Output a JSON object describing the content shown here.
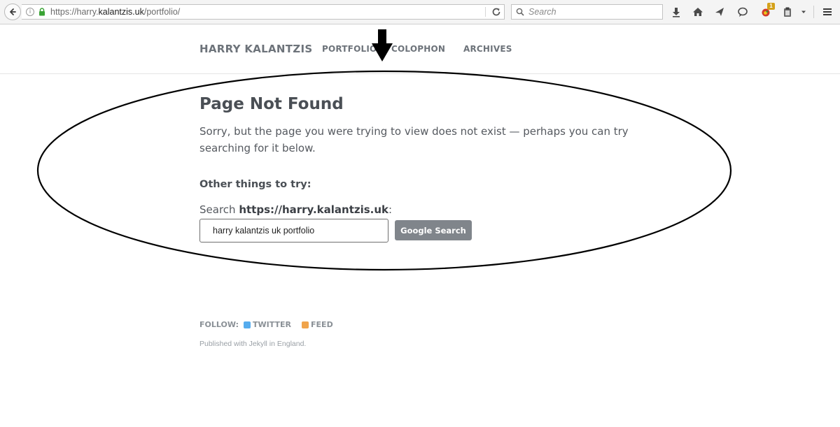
{
  "browser": {
    "url_prefix": "https://harry.",
    "url_domain": "kalantzis.uk",
    "url_path": "/portfolio/",
    "search_placeholder": "Search",
    "notification_badge": "1"
  },
  "site": {
    "title": "HARRY KALANTZIS",
    "nav": [
      "PORTFOLIO",
      "COLOPHON",
      "ARCHIVES"
    ]
  },
  "main": {
    "title": "Page Not Found",
    "intro": "Sorry, but the page you were trying to view does not exist — perhaps you can try searching for it below.",
    "subheading": "Other things to try:",
    "search_label_prefix": "Search ",
    "search_label_site": "https://harry.kalantzis.uk",
    "search_label_suffix": ":",
    "search_value": "harry kalantzis uk portfolio",
    "search_button": "Google Search"
  },
  "footer": {
    "follow_label": "FOLLOW:",
    "twitter": "TWITTER",
    "feed": "FEED",
    "published": "Published with Jekyll in England."
  },
  "colors": {
    "twitter_icon": "#55acee",
    "feed_icon": "#f0a44b",
    "button_bg": "#80858b",
    "annotation": "#000000"
  }
}
